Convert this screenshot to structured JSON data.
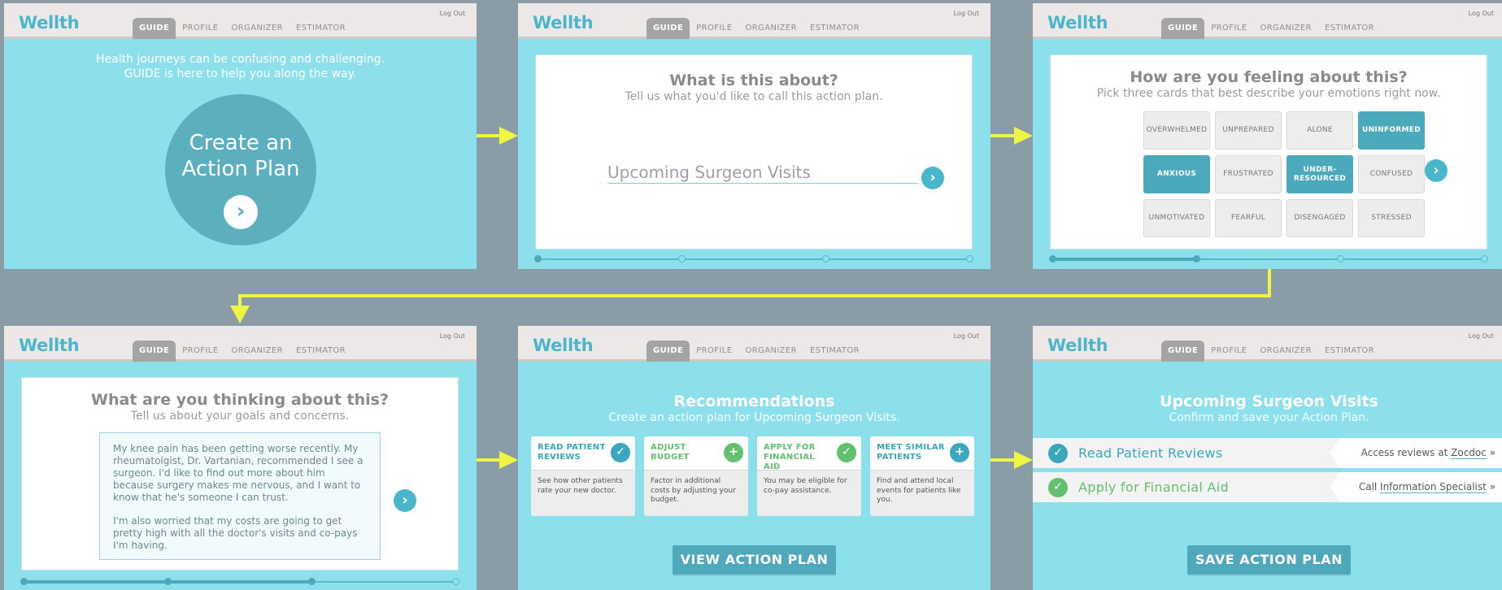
{
  "app": {
    "logo": "Wellth",
    "logout": "Log Out",
    "tabs": [
      "GUIDE",
      "PROFILE",
      "ORGANIZER",
      "ESTIMATOR"
    ]
  },
  "step1": {
    "intro_line1": "Health journeys can be confusing and challenging.",
    "intro_line2": "GUIDE is here to help you along the way.",
    "cta_line1": "Create an",
    "cta_line2": "Action Plan",
    "cta_icon": "chevron-right-icon"
  },
  "step2": {
    "title": "What is this about?",
    "subtitle": "Tell us what you'd like to call this action plan.",
    "input_value": "Upcoming Surgeon Visits",
    "progress_done": 0
  },
  "step3": {
    "title": "How are you feeling about this?",
    "subtitle": "Pick three cards that best describe your emotions right now.",
    "cards": [
      {
        "label": "OVERWHELMED",
        "selected": false
      },
      {
        "label": "UNPREPARED",
        "selected": false
      },
      {
        "label": "ALONE",
        "selected": false
      },
      {
        "label": "UNINFORMED",
        "selected": true
      },
      {
        "label": "ANXIOUS",
        "selected": true
      },
      {
        "label": "FRUSTRATED",
        "selected": false
      },
      {
        "label": "UNDER-RESOURCED",
        "selected": true
      },
      {
        "label": "CONFUSED",
        "selected": false
      },
      {
        "label": "UNMOTIVATED",
        "selected": false
      },
      {
        "label": "FEARFUL",
        "selected": false
      },
      {
        "label": "DISENGAGED",
        "selected": false
      },
      {
        "label": "STRESSED",
        "selected": false
      }
    ],
    "progress_done": 1
  },
  "step4": {
    "title": "What are you thinking about this?",
    "subtitle": "Tell us about your goals and concerns.",
    "paragraph1": "My knee pain has been getting worse recently. My rheumatolgist, Dr. Vartanian, recommended I see a surgeon. I'd like to find out more about him because surgery makes me nervous, and I want to know that he's someone I can trust.",
    "paragraph2": "I'm also worried that my costs are going to get pretty high with all the doctor's visits and co-pays I'm having.",
    "progress_done": 2
  },
  "step5": {
    "title": "Recommendations",
    "subtitle_prefix": "Create an action plan for ",
    "subtitle_plan": "Upcoming Surgeon Visits.",
    "recommendations": [
      {
        "title": "READ PATIENT REVIEWS",
        "desc": "See how other patients rate your new doctor.",
        "icon": "check-icon",
        "color": "#3aa7bd",
        "added": true
      },
      {
        "title": "ADJUST BUDGET",
        "desc": "Factor in additional costs by adjusting your budget.",
        "icon": "plus-icon",
        "color": "#63c06e",
        "added": false
      },
      {
        "title": "APPLY FOR FINANCIAL AID",
        "desc": "You may be eligible for co-pay assistance.",
        "icon": "check-icon",
        "color": "#63c06e",
        "added": true
      },
      {
        "title": "MEET SIMILAR PATIENTS",
        "desc": "Find and attend local events for patients like you.",
        "icon": "plus-icon",
        "color": "#3aa7bd",
        "added": false
      }
    ],
    "button": "VIEW ACTION PLAN"
  },
  "step6": {
    "title": "Upcoming Surgeon Visits",
    "subtitle": "Confirm and save your Action Plan.",
    "items": [
      {
        "label": "Read Patient Reviews",
        "link_prefix": "Access reviews at ",
        "link": "Zocdoc",
        "link_suffix": " »",
        "color": "#3aa7bd"
      },
      {
        "label": "Apply for Financial Aid",
        "link_prefix": "Call ",
        "link": "Information Specialist",
        "link_suffix": " »",
        "color": "#63c06e"
      }
    ],
    "button": "SAVE ACTION PLAN"
  },
  "colors": {
    "accent": "#4ab6cc",
    "arrow": "#eef542",
    "panel_bg": "#8ce0ec",
    "outer_bg": "#8a9ca6"
  }
}
